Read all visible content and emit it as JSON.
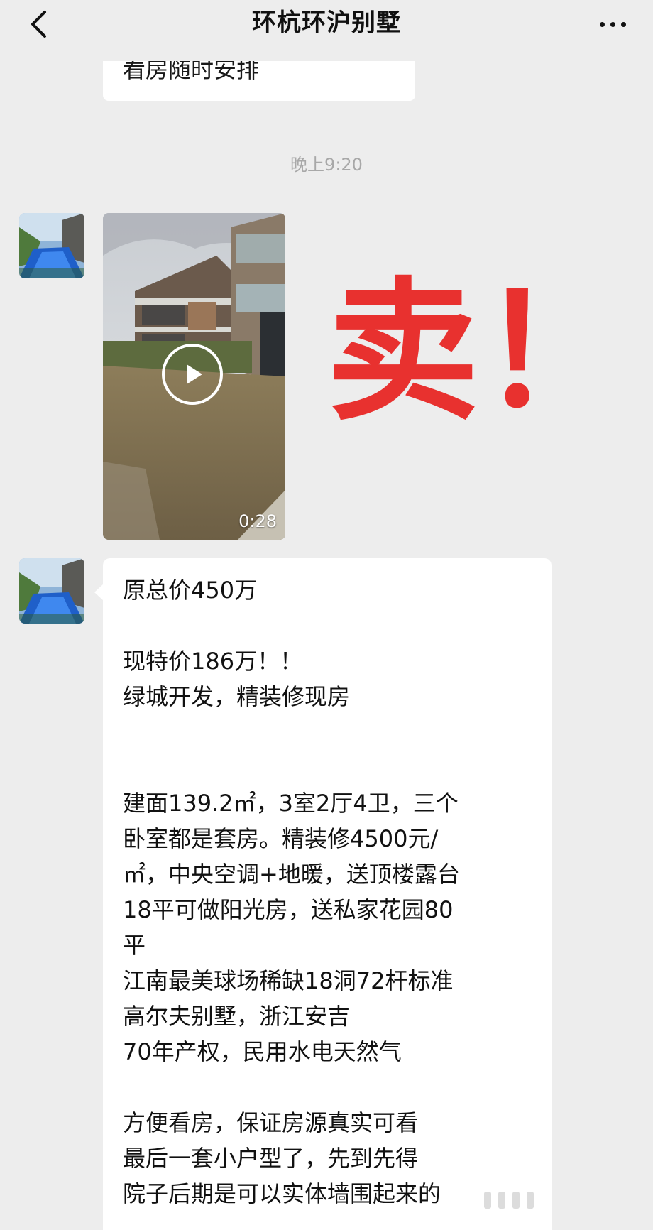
{
  "header": {
    "title": "环杭环沪别墅",
    "back_icon": "chevron-left-icon",
    "more_icon": "more-dots-icon"
  },
  "previous_message": {
    "text": "看房随时安排"
  },
  "timestamp": "晚上9:20",
  "video_message": {
    "duration": "0:28",
    "play_icon": "play-icon"
  },
  "sticker": {
    "text": "卖！",
    "color": "#e8312f"
  },
  "text_message": {
    "lines": [
      "原总价450万",
      "现特价186万！！",
      "绿城开发，精装修现房",
      "建面139.2㎡，3室2厅4卫，三个",
      "卧室都是套房。精装修4500元/",
      "㎡，中央空调+地暖，送顶楼露台",
      "18平可做阳光房，送私家花园80",
      "平",
      "江南最美球场稀缺18洞72杆标准",
      "高尔夫别墅，浙江安吉",
      "70年产权，民用水电天然气",
      "方便看房，保证房源真实可看",
      "最后一套小户型了，先到先得",
      "院子后期是可以实体墙围起来的"
    ]
  }
}
